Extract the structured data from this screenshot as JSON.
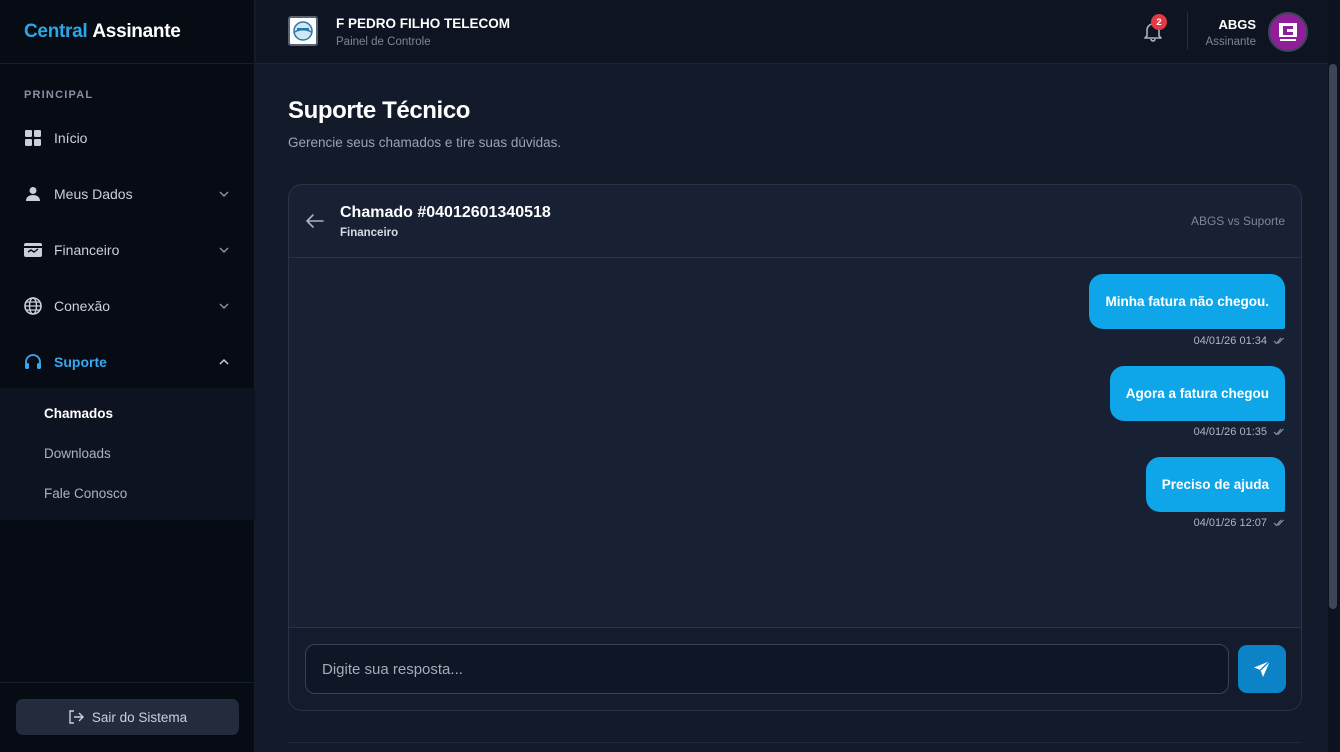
{
  "sidebar": {
    "brand_accent": "Central",
    "brand_rest": "Assinante",
    "section_label": "PRINCIPAL",
    "items": [
      {
        "label": "Início",
        "icon": "grid-icon"
      },
      {
        "label": "Meus Dados",
        "icon": "user-icon"
      },
      {
        "label": "Financeiro",
        "icon": "wallet-icon"
      },
      {
        "label": "Conexão",
        "icon": "globe-icon"
      },
      {
        "label": "Suporte",
        "icon": "headset-icon"
      }
    ],
    "submenu": [
      {
        "label": "Chamados"
      },
      {
        "label": "Downloads"
      },
      {
        "label": "Fale Conosco"
      }
    ],
    "logout_label": "Sair do Sistema"
  },
  "topbar": {
    "org_name": "F PEDRO FILHO TELECOM",
    "org_subtitle": "Painel de Controle",
    "notification_count": "2",
    "user_name": "ABGS",
    "user_role": "Assinante"
  },
  "main": {
    "title": "Suporte Técnico",
    "subtitle": "Gerencie seus chamados e tire suas dúvidas."
  },
  "ticket": {
    "title": "Chamado #04012601340518",
    "category": "Financeiro",
    "parties": "ABGS vs Suporte",
    "messages": [
      {
        "text": "Minha fatura não chegou.",
        "time": "04/01/26 01:34"
      },
      {
        "text": "Agora a fatura chegou",
        "time": "04/01/26 01:35"
      },
      {
        "text": "Preciso de ajuda",
        "time": "04/01/26 12:07"
      }
    ],
    "reply_placeholder": "Digite sua resposta..."
  },
  "colors": {
    "accent": "#0ea5e9",
    "sidebar_bg": "#070b14",
    "page_bg": "#131a2a",
    "badge": "#e53946",
    "avatar": "#8e1f99"
  }
}
